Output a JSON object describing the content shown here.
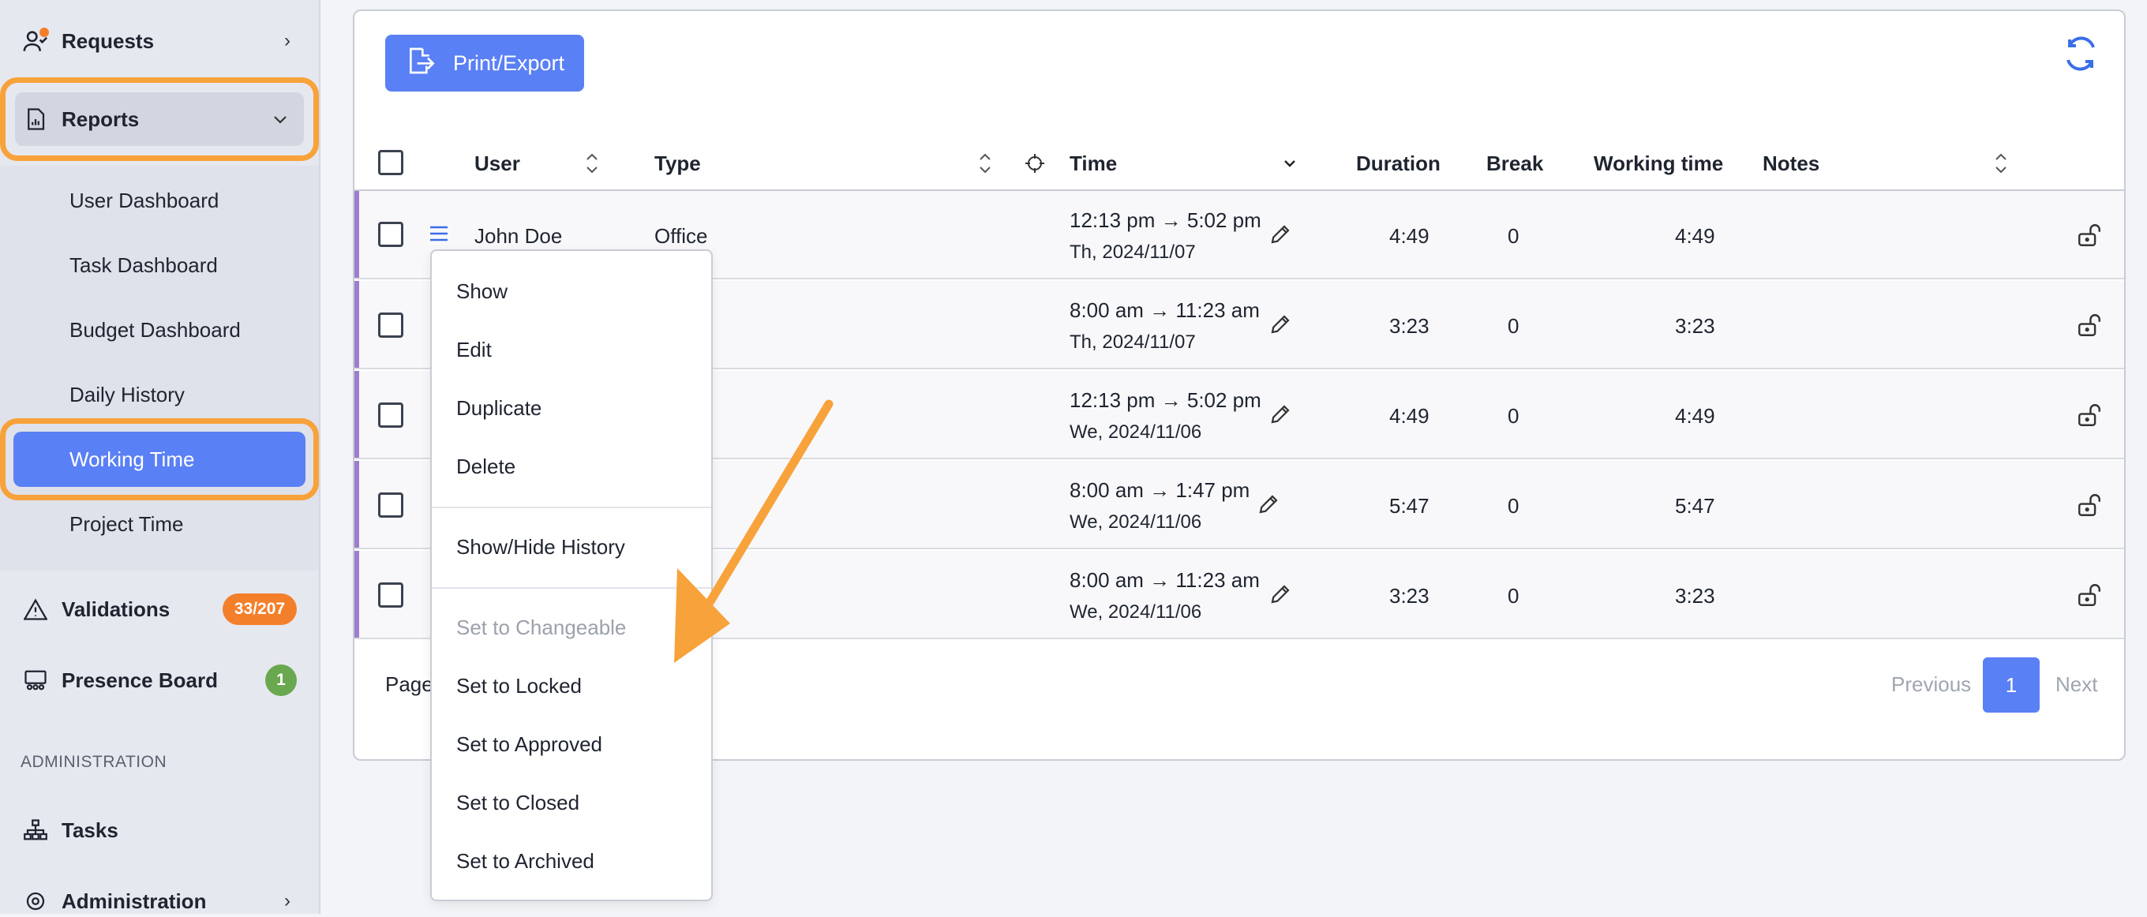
{
  "sidebar": {
    "requests": "Requests",
    "reports": "Reports",
    "sub_items": [
      "User Dashboard",
      "Task Dashboard",
      "Budget Dashboard",
      "Daily History",
      "Working Time",
      "Project Time"
    ],
    "validations": "Validations",
    "validations_badge": "33/207",
    "presence_board": "Presence Board",
    "presence_badge": "1",
    "admin_section": "ADMINISTRATION",
    "tasks": "Tasks",
    "administration": "Administration"
  },
  "toolbar": {
    "print_export": "Print/Export"
  },
  "table": {
    "headers": {
      "user": "User",
      "type": "Type",
      "time": "Time",
      "duration": "Duration",
      "break": "Break",
      "working_time": "Working time",
      "notes": "Notes"
    },
    "rows": [
      {
        "user": "John Doe",
        "type": "Office",
        "time_range": "12:13 pm → 5:02 pm",
        "date": "Th, 2024/11/07",
        "duration": "4:49",
        "break": "0",
        "working_time": "4:49"
      },
      {
        "user": "",
        "type": "",
        "time_range": "8:00 am → 11:23 am",
        "date": "Th, 2024/11/07",
        "duration": "3:23",
        "break": "0",
        "working_time": "3:23"
      },
      {
        "user": "",
        "type": "",
        "time_range": "12:13 pm → 5:02 pm",
        "date": "We, 2024/11/06",
        "duration": "4:49",
        "break": "0",
        "working_time": "4:49"
      },
      {
        "user": "",
        "type": "",
        "time_range": "8:00 am → 1:47 pm",
        "date": "We, 2024/11/06",
        "duration": "5:47",
        "break": "0",
        "working_time": "5:47"
      },
      {
        "user": "",
        "type": "",
        "time_range": "8:00 am → 11:23 am",
        "date": "We, 2024/11/06",
        "duration": "3:23",
        "break": "0",
        "working_time": "3:23"
      }
    ]
  },
  "pagination": {
    "page_label": "Page",
    "previous": "Previous",
    "current": "1",
    "next": "Next"
  },
  "context_menu": {
    "items": [
      "Show",
      "Edit",
      "Duplicate",
      "Delete",
      "Show/Hide History",
      "Set to Changeable",
      "Set to Locked",
      "Set to Approved",
      "Set to Closed",
      "Set to Archived"
    ],
    "disabled": [
      "Set to Changeable"
    ]
  },
  "colors": {
    "accent": "#5a80f5",
    "highlight": "#f7a23a",
    "row_marker": "#9b7fcc",
    "badge_orange": "#f47f2b",
    "badge_green": "#6aa84f"
  }
}
